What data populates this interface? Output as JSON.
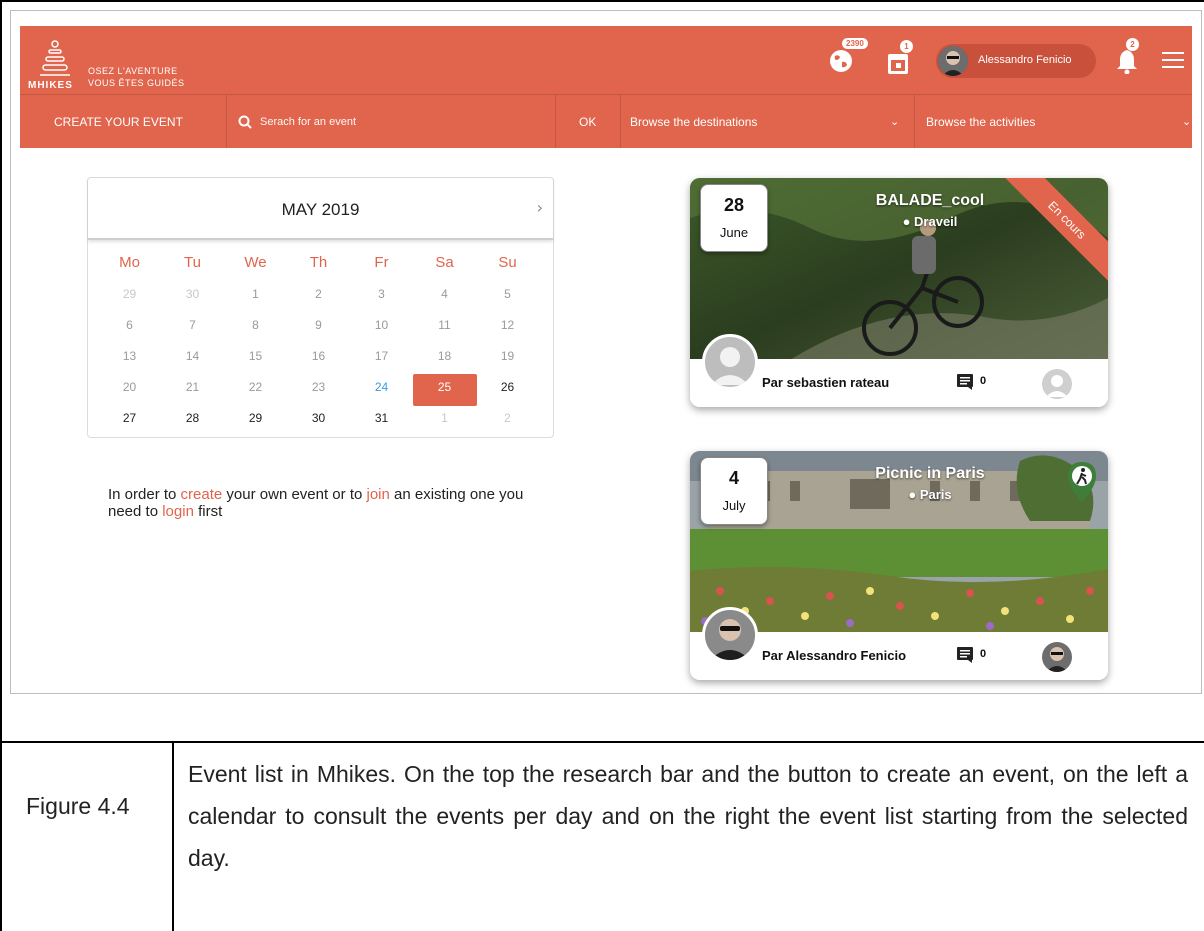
{
  "header": {
    "logo_brand": "MHIKES",
    "logo_tagline_1": "OSEZ L'AVENTURE",
    "logo_tagline_2": "VOUS ÊTES GUIDÉS",
    "globe_badge": "2390",
    "calendar_badge": "1",
    "user_name": "Alessandro Fenicio",
    "bell_badge": "2",
    "accent_color": "#e0654c"
  },
  "nav": {
    "create_event": "CREATE YOUR EVENT",
    "search_placeholder": "Serach for an event",
    "ok_label": "OK",
    "destinations": "Browse the destinations",
    "activities": "Browse the activities"
  },
  "calendar": {
    "month_title": "MAY 2019",
    "weekdays": [
      "Mo",
      "Tu",
      "We",
      "Th",
      "Fr",
      "Sa",
      "Su"
    ],
    "weeks": [
      [
        "29",
        "30",
        "1",
        "2",
        "3",
        "4",
        "5"
      ],
      [
        "6",
        "7",
        "8",
        "9",
        "10",
        "11",
        "12"
      ],
      [
        "13",
        "14",
        "15",
        "16",
        "17",
        "18",
        "19"
      ],
      [
        "20",
        "21",
        "22",
        "23",
        "24",
        "25",
        "26"
      ],
      [
        "27",
        "28",
        "29",
        "30",
        "31",
        "1",
        "2"
      ]
    ],
    "today": "24",
    "selected": "25"
  },
  "login_message": {
    "part1": "In order to ",
    "link_create": "create",
    "part2": " your own event or to ",
    "link_join": "join",
    "part3": " an existing one you need to ",
    "link_login": "login",
    "part4": " first"
  },
  "events": [
    {
      "day": "28",
      "month": "June",
      "title": "BALADE_cool",
      "location": "Draveil",
      "status_ribbon": "En cours",
      "organizer": "Par sebastien rateau",
      "comments": "0"
    },
    {
      "day": "4",
      "month": "July",
      "title": "Picnic in Paris",
      "location": "Paris",
      "organizer": "Par Alessandro Fenicio",
      "comments": "0"
    }
  ],
  "caption": {
    "label": "Figure 4.4",
    "text": "Event list in Mhikes. On the top the research bar and the button to create an event, on the left a calendar to consult the events per day and on the right the event list starting from the selected day."
  }
}
